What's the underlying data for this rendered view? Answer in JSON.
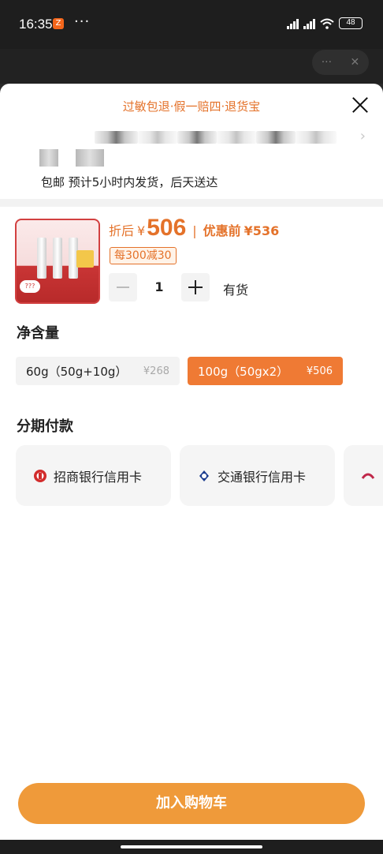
{
  "status_bar": {
    "time": "16:35",
    "app_icon": "Z",
    "dots": "···",
    "battery": "48"
  },
  "capsule": {
    "more": "···",
    "close": "✕"
  },
  "sheet": {
    "guarantee": "过敏包退·假一赔四·退货宝",
    "delivery": "包邮 预计5小时内发货，后天送达"
  },
  "product": {
    "price_after_label": "折后",
    "currency": "¥",
    "price_after": "506",
    "separator": "|",
    "price_before_label": "优惠前",
    "price_before": "¥536",
    "promo": "每300减30",
    "quantity": "1",
    "stock": "有货"
  },
  "net_content": {
    "title": "净含量",
    "options": [
      {
        "label": "60g（50g+10g）",
        "price": "¥268",
        "selected": false
      },
      {
        "label": "100g（50gx2）",
        "price": "¥506",
        "selected": true
      }
    ]
  },
  "installment": {
    "title": "分期付款",
    "options": [
      {
        "label": "招商银行信用卡",
        "icon": "cmb-bank-icon"
      },
      {
        "label": "交通银行信用卡",
        "icon": "bocom-bank-icon"
      },
      {
        "label": "",
        "icon": "bank-icon"
      }
    ]
  },
  "actions": {
    "add_to_cart": "加入购物车"
  },
  "colors": {
    "accent": "#e4722a",
    "selected_option": "#ef7a34",
    "cart_button": "#ef9a3a"
  }
}
